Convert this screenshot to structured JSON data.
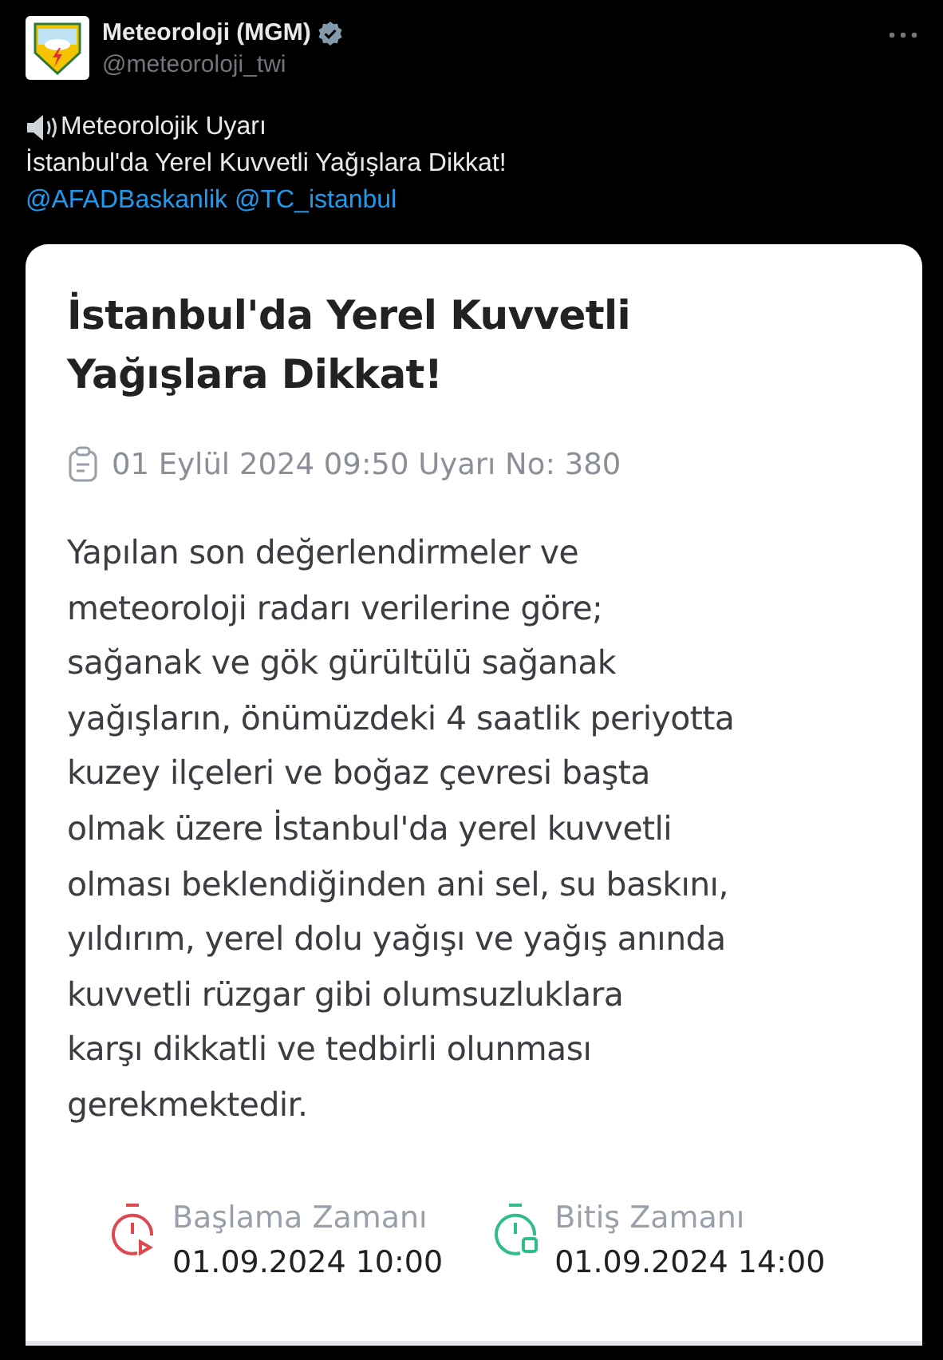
{
  "account": {
    "name": "Meteoroloji (MGM)",
    "handle": "@meteoroloji_twi",
    "verified": true
  },
  "tweet": {
    "heading": "Meteorolojik Uyarı",
    "text": "İstanbul'da Yerel Kuvvetli Yağışlara Dikkat!",
    "mentions": [
      "@AFADBaskanlik",
      "@TC_istanbul"
    ]
  },
  "card": {
    "title_lines": [
      "İstanbul'da Yerel Kuvvetli",
      "Yağışlara Dikkat!"
    ],
    "meta": "01 Eylül 2024 09:50 Uyarı No: 380",
    "body_lines": [
      "Yapılan son değerlendirmeler ve",
      "meteoroloji radarı verilerine göre;",
      "sağanak ve gök gürültülü sağanak",
      "yağışların, önümüzdeki 4 saatlik periyotta",
      "kuzey ilçeleri ve boğaz çevresi başta",
      "olmak üzere İstanbul'da yerel kuvvetli",
      "olması beklendiğinden ani sel, su baskını,",
      "yıldırım, yerel dolu yağışı ve yağış anında",
      "kuvvetli rüzgar gibi olumsuzluklara",
      "karşı dikkatli ve tedbirli olunması",
      "gerekmektedir."
    ],
    "times": [
      {
        "kind": "start",
        "label": "Başlama Zamanı",
        "value": "01.09.2024 10:00",
        "color": "#e0484f"
      },
      {
        "kind": "end",
        "label": "Bitiş Zamanı",
        "value": "01.09.2024 14:00",
        "color": "#2fbf86"
      }
    ]
  }
}
